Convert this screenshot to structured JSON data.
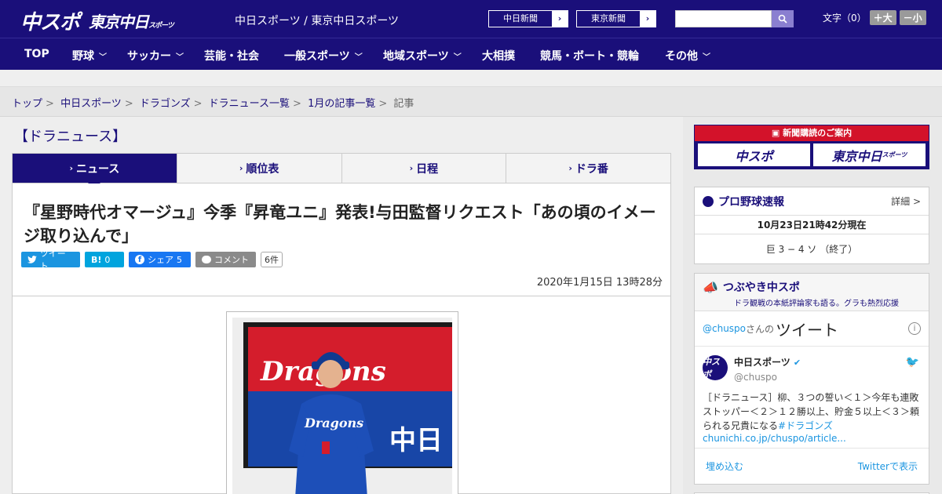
{
  "header": {
    "logo_main": "中スポ",
    "logo_tokyo": "東京中日",
    "logo_tokyo_small": "スポーツ",
    "site_name": "中日スポーツ / 東京中日スポーツ",
    "newspaper_links": [
      "中日新聞",
      "東京新聞"
    ],
    "search_placeholder": "",
    "font_size_label": "文字（0）",
    "font_larger": "＋大",
    "font_smaller": "－小"
  },
  "nav": [
    {
      "label": "TOP",
      "dropdown": false
    },
    {
      "label": "野球",
      "dropdown": true
    },
    {
      "label": "サッカー",
      "dropdown": true
    },
    {
      "label": "芸能・社会",
      "dropdown": false
    },
    {
      "label": "一般スポーツ",
      "dropdown": true
    },
    {
      "label": "地域スポーツ",
      "dropdown": true
    },
    {
      "label": "大相撲",
      "dropdown": false
    },
    {
      "label": "競馬・ボート・競輪",
      "dropdown": false
    },
    {
      "label": "その他",
      "dropdown": true
    }
  ],
  "breadcrumb": {
    "links": [
      "トップ",
      "中日スポーツ",
      "ドラゴンズ",
      "ドラニュース一覧",
      "1月の記事一覧"
    ],
    "current": "記事"
  },
  "section_title": "【ドラニュース】",
  "tabs": [
    {
      "label": "ニュース",
      "active": true
    },
    {
      "label": "順位表",
      "active": false
    },
    {
      "label": "日程",
      "active": false
    },
    {
      "label": "ドラ番",
      "active": false
    }
  ],
  "article": {
    "headline": "『星野時代オマージュ』今季『昇竜ユニ』発表!与田監督リクエスト「あの頃のイメージ取り込んで」",
    "share": {
      "tweet": "ツイート",
      "hatena_icon": "B!",
      "hatena_count": "0",
      "fb": "シェア",
      "fb_count": "5",
      "comment": "コメント",
      "comment_count": "6件"
    },
    "date": "2020年1月15日 13時28分",
    "photo_banner_text": "Dragons",
    "photo_jersey_text": "Dragons",
    "photo_board_text": "中日"
  },
  "sidebar": {
    "ad": {
      "title": "新聞購読のご案内",
      "logo1": "中スポ",
      "logo2": "東京中日",
      "logo2_small": "スポーツ"
    },
    "baseball": {
      "title": "プロ野球速報",
      "more": "詳細 >",
      "as_of": "10月23日21時42分現在",
      "score": "巨 3 − 4 ソ （終了）"
    },
    "tsubuyaki": {
      "title": "つぶやき中スポ",
      "subtitle": "ドラ観戦の本紙評論家も語る。グラも熱烈応援",
      "handle": "@chuspo",
      "san": "さんの",
      "tweet_word": "ツイート",
      "account_name": "中日スポーツ",
      "account_handle": "@chuspo",
      "avatar_text": "中スポ",
      "tweet_text": "［ドラニュース］柳、３つの誓い＜１＞今年も連敗ストッパー＜２＞１２勝以上、貯金５以上＜３＞頼られる兄貴になる",
      "tweet_tag": "#ドラゴンズ",
      "tweet_link": "chunichi.co.jp/chuspo/article...",
      "embed": "埋め込む",
      "view_on_twitter": "Twitterで表示"
    }
  },
  "colors": {
    "brand": "#1a0f7a",
    "twitter": "#1b95e0",
    "facebook": "#1877f2",
    "ad_red": "#d3122a"
  }
}
